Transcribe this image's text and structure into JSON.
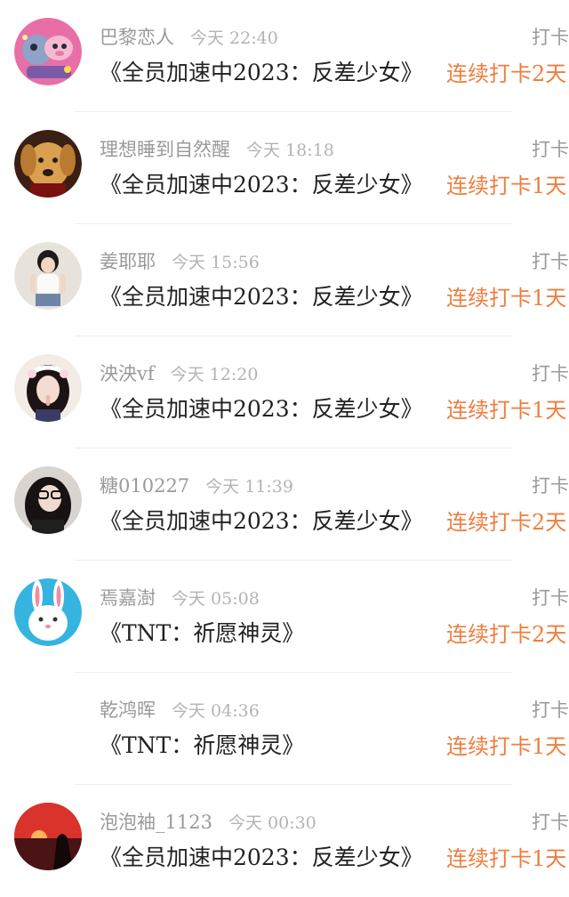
{
  "checkins": [
    {
      "avatar": "avatar-cartoon-animals",
      "name": "巴黎恋人",
      "time": "今天 22:40",
      "action": "打卡",
      "title": "《全员加速中2023：反差少女》",
      "streak": "连续打卡2天"
    },
    {
      "avatar": "avatar-puppy-photo",
      "name": "理想睡到自然醒",
      "time": "今天 18:18",
      "action": "打卡",
      "title": "《全员加速中2023：反差少女》",
      "streak": "连续打卡1天"
    },
    {
      "avatar": "avatar-girl-photo",
      "name": "姜耶耶",
      "time": "今天 15:56",
      "action": "打卡",
      "title": "《全员加速中2023：反差少女》",
      "streak": "连续打卡1天"
    },
    {
      "avatar": "avatar-girl-headband",
      "name": "泱泱vf",
      "time": "今天 12:20",
      "action": "打卡",
      "title": "《全员加速中2023：反差少女》",
      "streak": "连续打卡1天"
    },
    {
      "avatar": "avatar-glasses-portrait",
      "name": "糖010227",
      "time": "今天 11:39",
      "action": "打卡",
      "title": "《全员加速中2023：反差少女》",
      "streak": "连续打卡2天"
    },
    {
      "avatar": "avatar-rabbit-illustration",
      "name": "焉嘉澍",
      "time": "今天 05:08",
      "action": "打卡",
      "title": "《TNT：祈愿神灵》",
      "streak": "连续打卡2天"
    },
    {
      "avatar": "avatar-blank",
      "name": "乾鸿晖",
      "time": "今天 04:36",
      "action": "打卡",
      "title": "《TNT：祈愿神灵》",
      "streak": "连续打卡1天"
    },
    {
      "avatar": "avatar-sunset-silhouette",
      "name": "泡泡袖_1123",
      "time": "今天 00:30",
      "action": "打卡",
      "title": "《全员加速中2023：反差少女》",
      "streak": "连续打卡1天"
    }
  ],
  "colors": {
    "streak": "#ef7e3d",
    "muted": "#9a9a9a",
    "title": "#222222",
    "divider": "#eeeeee"
  }
}
